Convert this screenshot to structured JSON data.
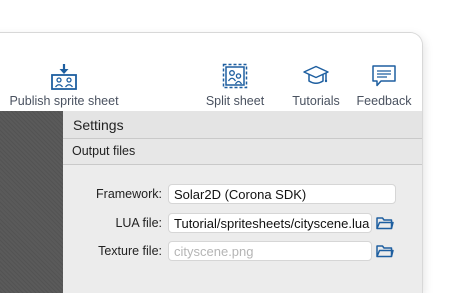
{
  "toolbar": {
    "publish_label": "Publish sprite sheet",
    "split_label": "Split sheet",
    "tutorials_label": "Tutorials",
    "feedback_label": "Feedback",
    "icon_color": "#1e5fa0"
  },
  "settings": {
    "title": "Settings",
    "section": "Output files",
    "framework_label": "Framework:",
    "framework_value": "Solar2D (Corona SDK)",
    "lua_label": "LUA file:",
    "lua_value": "Tutorial/spritesheets/cityscene.lua",
    "texture_label": "Texture file:",
    "texture_placeholder": "cityscene.png"
  }
}
